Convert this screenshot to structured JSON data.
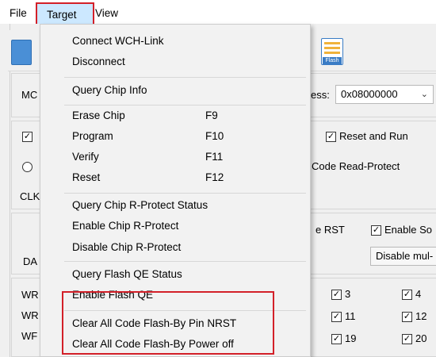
{
  "menubar": {
    "file": "File",
    "target": "Target",
    "view": "View"
  },
  "background": {
    "mc_label": "MC",
    "address_label": "ess:",
    "address_value": "0x08000000",
    "reset_and_run": "Reset and Run",
    "code_read_protect": "Code Read-Protect",
    "clk_label": "CLK",
    "da_label": "DA",
    "rst_label": "e RST",
    "enable_so": "Enable So",
    "disable_mul": "Disable mul-",
    "wr1": "WR",
    "wr2": "WR",
    "wr3": "WF",
    "flash_icon_label": "Flash",
    "checkboxes": [
      "3",
      "4",
      "11",
      "12",
      "19",
      "20"
    ]
  },
  "menu": {
    "items": [
      {
        "label": "Connect  WCH-Link",
        "key": ""
      },
      {
        "label": "Disconnect",
        "key": ""
      },
      {
        "label": "Query Chip Info",
        "key": ""
      },
      {
        "label": "Erase Chip",
        "key": "F9"
      },
      {
        "label": "Program",
        "key": "F10"
      },
      {
        "label": "Verify",
        "key": "F11"
      },
      {
        "label": "Reset",
        "key": "F12"
      },
      {
        "label": "Query Chip R-Protect Status",
        "key": ""
      },
      {
        "label": "Enable Chip R-Protect",
        "key": ""
      },
      {
        "label": "Disable Chip R-Protect",
        "key": ""
      },
      {
        "label": "Query Flash QE Status",
        "key": ""
      },
      {
        "label": "Enable Flash QE",
        "key": ""
      },
      {
        "label": "Clear All Code Flash-By Pin NRST",
        "key": ""
      },
      {
        "label": "Clear All Code Flash-By Power off",
        "key": ""
      }
    ]
  },
  "colors": {
    "highlight_border": "#d32029",
    "menu_hover": "#cce8ff",
    "menu_bg": "#f2f2f2"
  }
}
